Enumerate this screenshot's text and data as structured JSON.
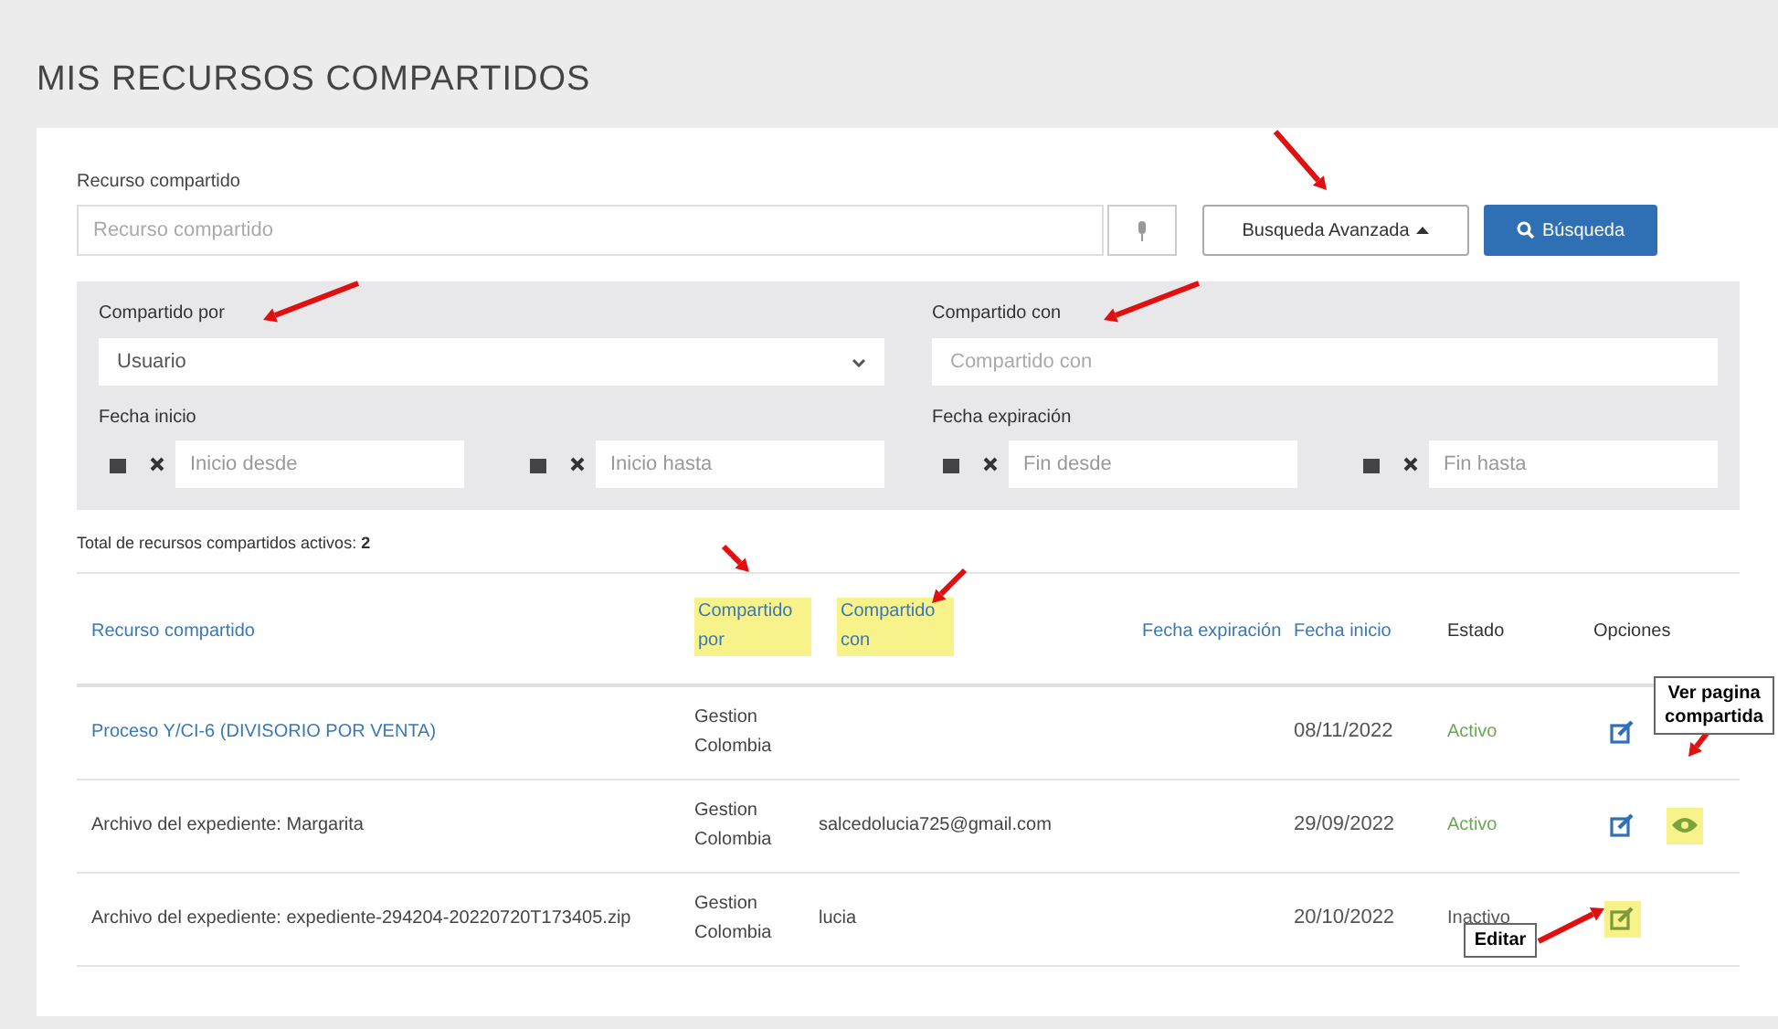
{
  "title": "MIS RECURSOS COMPARTIDOS",
  "search": {
    "label": "Recurso compartido",
    "placeholder": "Recurso compartido",
    "advanced_button": "Busqueda Avanzada",
    "search_button": "Búsqueda",
    "advanced_expanded": true
  },
  "filters": {
    "shared_by": {
      "label": "Compartido por",
      "value": "Usuario"
    },
    "shared_with": {
      "label": "Compartido con",
      "placeholder": "Compartido con"
    },
    "start_date": {
      "label": "Fecha inicio",
      "from_placeholder": "Inicio desde",
      "to_placeholder": "Inicio hasta"
    },
    "expiry_date": {
      "label": "Fecha expiración",
      "from_placeholder": "Fin desde",
      "to_placeholder": "Fin hasta"
    }
  },
  "total": {
    "text": "Total de recursos compartidos activos: ",
    "count": "2"
  },
  "table": {
    "columns": [
      {
        "label": "Recurso compartido",
        "sortable": true,
        "highlighted": false
      },
      {
        "label": "Compartido por",
        "sortable": true,
        "highlighted": true
      },
      {
        "label": "Compartido con",
        "sortable": true,
        "highlighted": true
      },
      {
        "label": "Fecha expiración",
        "sortable": true,
        "highlighted": false
      },
      {
        "label": "Fecha inicio",
        "sortable": true,
        "highlighted": false
      },
      {
        "label": "Estado",
        "sortable": false,
        "highlighted": false
      },
      {
        "label": "Opciones",
        "sortable": false,
        "highlighted": false
      }
    ],
    "rows": [
      {
        "resource": "Proceso Y/CI-6 (DIVISORIO POR VENTA)",
        "resource_is_link": true,
        "shared_by": "Gestion Colombia",
        "start": "08/11/2022",
        "status": "Activo",
        "active": true,
        "actions": [
          {
            "kind": "edit",
            "highlighted": false
          }
        ]
      },
      {
        "resource": "Archivo del expediente: Margarita",
        "resource_is_link": false,
        "shared_by": "Gestion Colombia",
        "shared_with": "salcedolucia725@gmail.com",
        "start": "29/09/2022",
        "status": "Activo",
        "active": true,
        "actions": [
          {
            "kind": "edit",
            "highlighted": false
          },
          {
            "kind": "view",
            "highlighted": true
          }
        ]
      },
      {
        "resource": "Archivo del expediente: expediente-294204-20220720T173405.zip",
        "resource_is_link": false,
        "shared_by": "Gestion Colombia",
        "shared_with": "lucia",
        "start": "20/10/2022",
        "status": "Inactivo",
        "active": false,
        "actions": [
          {
            "kind": "edit",
            "highlighted": true
          }
        ]
      }
    ]
  },
  "callouts": [
    {
      "text": "Ver pagina compartida"
    },
    {
      "text": "Editar"
    }
  ]
}
